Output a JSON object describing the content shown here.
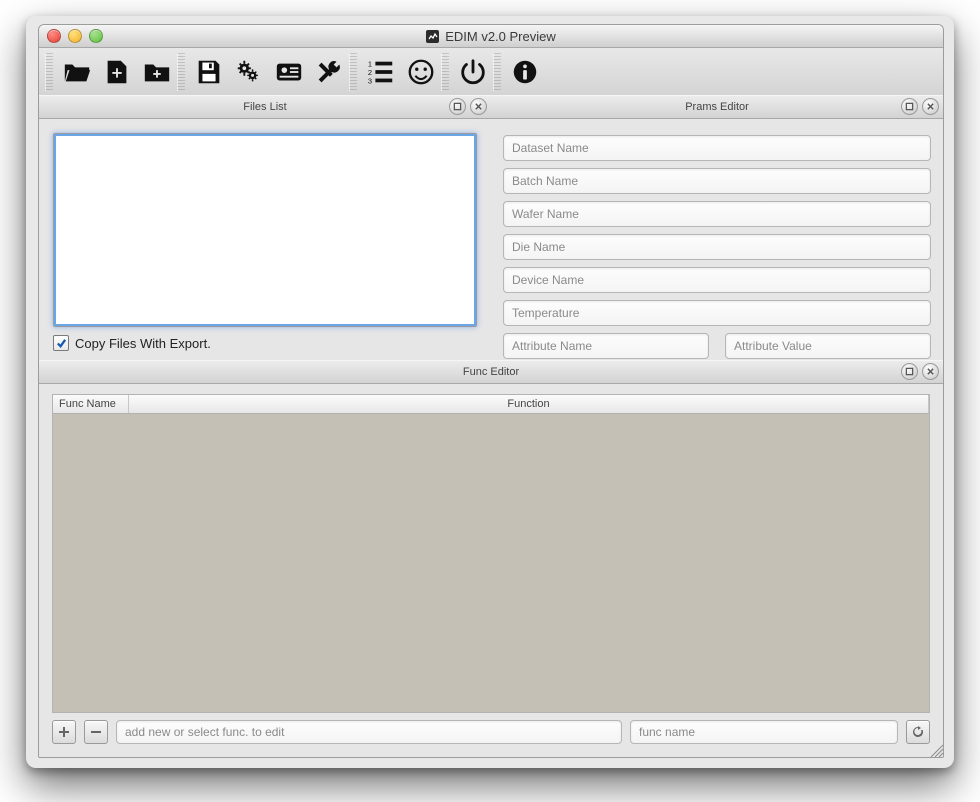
{
  "window": {
    "title": "EDIM v2.0 Preview"
  },
  "panels": {
    "files": {
      "title": "Files List",
      "copy_checkbox_label": "Copy Files With Export.",
      "copy_checked": true
    },
    "prams": {
      "title": "Prams Editor",
      "fields": {
        "dataset_ph": "Dataset Name",
        "batch_ph": "Batch Name",
        "wafer_ph": "Wafer Name",
        "die_ph": "Die Name",
        "device_ph": "Device Name",
        "temp_ph": "Temperature",
        "attr_name_ph": "Attribute Name",
        "attr_value_ph": "Attribute Value"
      }
    },
    "func": {
      "title": "Func Editor",
      "columns": {
        "name": "Func Name",
        "function": "Function"
      },
      "rows": [],
      "footer": {
        "edit_ph": "add new or select func. to edit",
        "name_ph": "func name"
      }
    }
  },
  "toolbar": {
    "items": [
      "open-folder",
      "new-file",
      "new-folder",
      "save",
      "settings-gears",
      "image-card",
      "tools-wrench",
      "numbered-list",
      "smile",
      "power",
      "info"
    ]
  }
}
